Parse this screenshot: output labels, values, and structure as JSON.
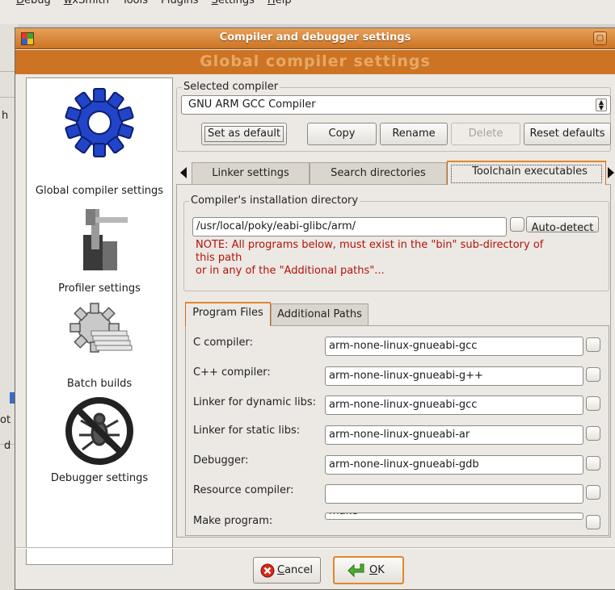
{
  "menubar": {
    "items": [
      {
        "label": "Debug",
        "u": "D"
      },
      {
        "label": "wxSmith",
        "u": "w"
      },
      {
        "label": "Tools",
        "u": ""
      },
      {
        "label": "Plugins",
        "u": ""
      },
      {
        "label": "Settings",
        "u": "S"
      },
      {
        "label": "Help",
        "u": "H"
      }
    ]
  },
  "background": {
    "edge_texts": [
      "h",
      "ot",
      "d"
    ]
  },
  "window": {
    "title": "Compiler and debugger settings",
    "banner": "Global compiler settings"
  },
  "sidebar": {
    "items": [
      {
        "label": "Global compiler settings",
        "icon": "gear-icon",
        "selected": true
      },
      {
        "label": "Profiler settings",
        "icon": "caliper-icon",
        "selected": false
      },
      {
        "label": "Batch builds",
        "icon": "batch-gear-icon",
        "selected": false
      },
      {
        "label": "Debugger settings",
        "icon": "no-bug-icon",
        "selected": false
      }
    ]
  },
  "selected_compiler": {
    "title": "Selected compiler",
    "value": "GNU ARM GCC Compiler",
    "buttons": {
      "set_default": "Set as default",
      "copy": "Copy",
      "rename": "Rename",
      "delete": "Delete",
      "reset": "Reset defaults"
    }
  },
  "tabs": {
    "items": [
      "Linker settings",
      "Search directories",
      "Toolchain executables"
    ],
    "active": 2
  },
  "install_dir": {
    "title": "Compiler's installation directory",
    "value": "/usr/local/poky/eabi-glibc/arm/",
    "auto_detect": "Auto-detect",
    "note_lines": [
      "NOTE: All programs below, must exist in the \"bin\" sub-directory of",
      "this path",
      "or in any of the \"Additional paths\"..."
    ]
  },
  "subtabs": {
    "items": [
      "Program Files",
      "Additional Paths"
    ],
    "active": 0
  },
  "programs": [
    {
      "label": "C compiler:",
      "value": "arm-none-linux-gnueabi-gcc"
    },
    {
      "label": "C++ compiler:",
      "value": "arm-none-linux-gnueabi-g++"
    },
    {
      "label": "Linker for dynamic libs:",
      "value": "arm-none-linux-gnueabi-gcc"
    },
    {
      "label": "Linker for static libs:",
      "value": "arm-none-linux-gnueabi-ar"
    },
    {
      "label": "Debugger:",
      "value": "arm-none-linux-gnueabi-gdb"
    },
    {
      "label": "Resource compiler:",
      "value": ""
    },
    {
      "label": "Make program:",
      "value": "make"
    }
  ],
  "dialog_buttons": {
    "cancel": {
      "label": "Cancel",
      "u": "C"
    },
    "ok": {
      "label": "OK",
      "u": "O"
    }
  },
  "colors": {
    "accent": "#cc7424",
    "note": "#b3120a"
  }
}
